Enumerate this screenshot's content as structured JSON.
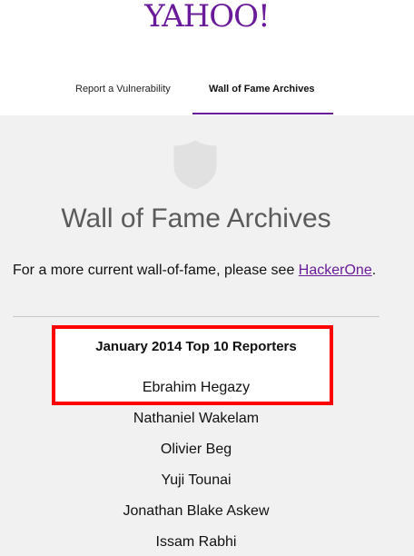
{
  "header": {
    "logo_text": "YAHOO!",
    "brand_color": "#6a1b9a"
  },
  "nav": {
    "items": [
      {
        "label": "Report a Vulnerability",
        "active": false
      },
      {
        "label": "Wall of Fame Archives",
        "active": true
      }
    ]
  },
  "main": {
    "shield_icon": "shield-icon",
    "title": "Wall of Fame Archives",
    "intro_text": "For a more current wall-of-fame, please see ",
    "intro_link": "HackerOne",
    "intro_end": "."
  },
  "section": {
    "title": "January 2014 Top 10 Reporters",
    "highlight_color": "#ff0000",
    "reporters": [
      "Ebrahim Hegazy",
      "Nathaniel Wakelam",
      "Olivier Beg",
      "Yuji Tounai",
      "Jonathan Blake Askew",
      "Issam Rabhi"
    ]
  }
}
